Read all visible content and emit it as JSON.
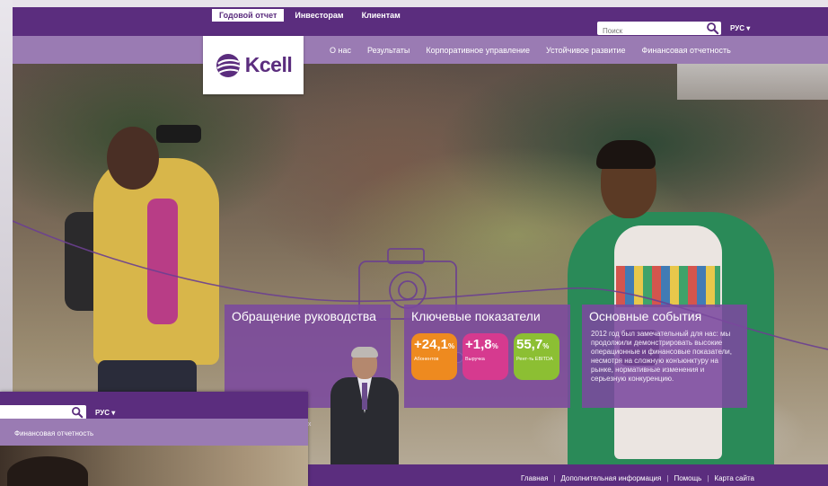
{
  "brand": {
    "name": "Kcell",
    "color": "#5b2d7e",
    "nav_color": "#9a7bb3"
  },
  "topbar": {
    "links": [
      "Годовой отчет",
      "Инвесторам",
      "Клиентам"
    ],
    "active_link": "Годовой отчет",
    "search_placeholder": "Поиск",
    "language": "РУС"
  },
  "nav": {
    "items": [
      "О нас",
      "Результаты",
      "Корпоративное управление",
      "Устойчивое развитие",
      "Финансовая отчетность"
    ]
  },
  "slider": {
    "dot_count": 5,
    "active_index": 1
  },
  "tiles": {
    "management": {
      "title": "Обращение руководства",
      "snippet": "ые ных"
    },
    "kpi": {
      "title": "Ключевые показатели",
      "items": [
        {
          "value": "+24,1",
          "unit": "%",
          "label": "Абонентов",
          "color": "#ee8a1f"
        },
        {
          "value": "+1,8",
          "unit": "%",
          "label": "Выручка",
          "color": "#d63a8f"
        },
        {
          "value": "55,7",
          "unit": "%",
          "label": "Рент-ть EBITDA",
          "color": "#8cbf33"
        }
      ]
    },
    "events": {
      "title": "Основные события",
      "text": "2012 год был замечательный для нас: мы продолжили демонстрировать высокие операционные и финансовые показатели, несмотря на сложную конъюнктуру на рынке, нормативные изменения и серьезную конкуренцию."
    }
  },
  "footer": {
    "links": [
      "Главная",
      "Дополнительная информация",
      "Помощь",
      "Карта сайта"
    ]
  },
  "zoom": {
    "language": "РУС",
    "nav_item": "Финансовая отчетность"
  }
}
